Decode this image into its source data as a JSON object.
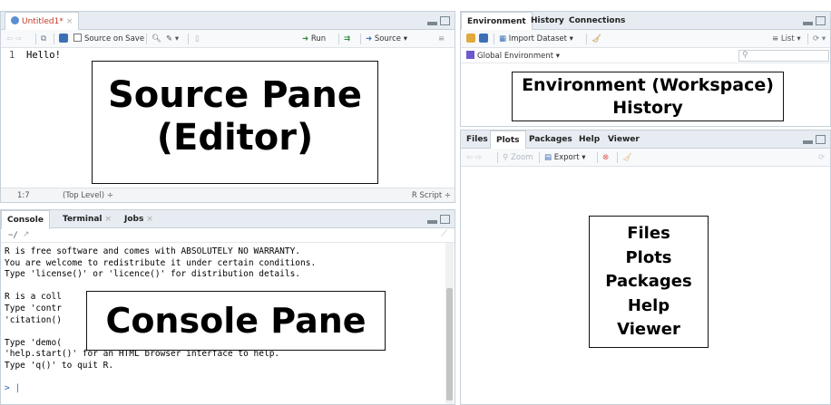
{
  "source_pane": {
    "tab_label": "Untitled1*",
    "tab_close": "×",
    "source_on_save": "Source on Save",
    "run_label": "Run",
    "source_label": "Source",
    "code_line_number": "1",
    "code_text": "Hello!",
    "overlay_line1": "Source Pane",
    "overlay_line2": "(Editor)",
    "status_position": "1:7",
    "status_scope": "(Top Level) ÷",
    "status_type": "R Script ÷"
  },
  "console_pane": {
    "tabs": [
      "Console",
      "Terminal",
      "Jobs"
    ],
    "tab_close": "×",
    "path": "~/",
    "lines": [
      "R is free software and comes with ABSOLUTELY NO WARRANTY.",
      "You are welcome to redistribute it under certain conditions.",
      "Type 'license()' or 'licence()' for distribution details.",
      "",
      "R is a coll",
      "Type 'contr",
      "'citation()",
      "",
      "Type 'demo(",
      "'help.start()' for an HTML browser interface to help.",
      "Type 'q()' to quit R.",
      "",
      "> |"
    ],
    "overlay_text": "Console Pane"
  },
  "environment_pane": {
    "tabs": [
      "Environment",
      "History",
      "Connections"
    ],
    "import_dataset": "Import Dataset",
    "list_label": "List",
    "global_env": "Global Environment",
    "overlay_line1": "Environment (Workspace)",
    "overlay_line2": "History"
  },
  "files_pane": {
    "tabs": [
      "Files",
      "Plots",
      "Packages",
      "Help",
      "Viewer"
    ],
    "zoom_label": "Zoom",
    "export_label": "Export",
    "overlay_lines": [
      "Files",
      "Plots",
      "Packages",
      "Help",
      "Viewer"
    ]
  },
  "colors": {
    "accent_red": "#d9534f",
    "tab_bg": "#e6ecf2",
    "run_green": "#2f8a3b"
  }
}
